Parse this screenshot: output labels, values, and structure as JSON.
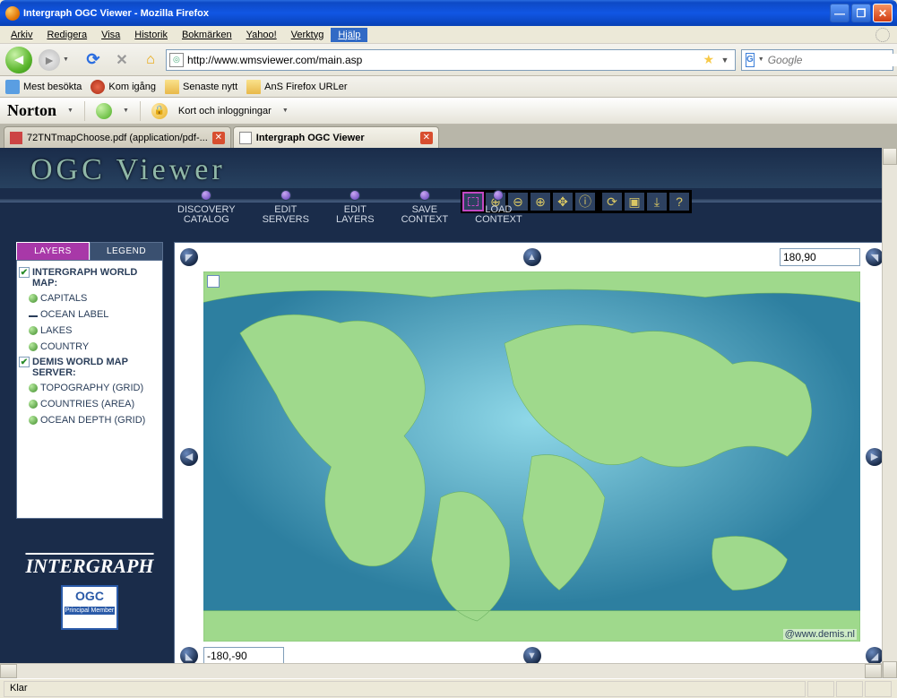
{
  "window": {
    "title": "Intergraph OGC Viewer - Mozilla Firefox"
  },
  "menu": [
    "Arkiv",
    "Redigera",
    "Visa",
    "Historik",
    "Bokmärken",
    "Yahoo!",
    "Verktyg",
    "Hjälp"
  ],
  "menu_selected_index": 7,
  "url": "http://www.wmsviewer.com/main.asp",
  "search_placeholder": "Google",
  "bookmarks": [
    "Mest besökta",
    "Kom igång",
    "Senaste nytt",
    "AnS Firefox URLer"
  ],
  "norton": {
    "logo": "Norton",
    "cards": "Kort och inloggningar"
  },
  "tabs": [
    {
      "label": "72TNTmapChoose.pdf (application/pdf-...",
      "active": false
    },
    {
      "label": "Intergraph OGC Viewer",
      "active": true
    }
  ],
  "viewer": {
    "brand": "OGC Viewer",
    "menu_items": [
      {
        "line1": "DISCOVERY",
        "line2": "CATALOG"
      },
      {
        "line1": "EDIT",
        "line2": "SERVERS"
      },
      {
        "line1": "EDIT",
        "line2": "LAYERS"
      },
      {
        "line1": "SAVE",
        "line2": "CONTEXT"
      },
      {
        "line1": "LOAD",
        "line2": "CONTEXT"
      }
    ],
    "left_tabs": {
      "active": "LAYERS",
      "inactive": "LEGEND"
    },
    "coord_ne": "180,90",
    "coord_sw": "-180,-90",
    "attribution": "@www.demis.nl",
    "footer_logo": "INTERGRAPH",
    "ogc_badge": {
      "top": "OGC",
      "bottom": "Principal Member"
    }
  },
  "layers": {
    "groups": [
      {
        "title": "INTERGRAPH WORLD MAP:",
        "checked": true,
        "items": [
          {
            "label": "CAPITALS",
            "style": "bead"
          },
          {
            "label": "OCEAN LABEL",
            "style": "dash"
          },
          {
            "label": "LAKES",
            "style": "bead"
          },
          {
            "label": "COUNTRY",
            "style": "bead"
          }
        ]
      },
      {
        "title": "DEMIS WORLD MAP SERVER:",
        "checked": true,
        "items": [
          {
            "label": "TOPOGRAPHY (GRID)",
            "style": "bead"
          },
          {
            "label": "COUNTRIES (AREA)",
            "style": "bead"
          },
          {
            "label": "OCEAN DEPTH (GRID)",
            "style": "bead"
          }
        ]
      }
    ]
  },
  "status": "Klar"
}
